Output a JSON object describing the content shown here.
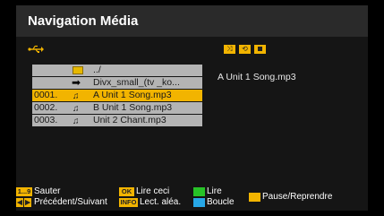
{
  "header": {
    "title": "Navigation Média"
  },
  "icons": {
    "usb": "usb-icon",
    "shuffle": "shuffle-icon",
    "repeat": "repeat-icon",
    "stop": "stop-icon"
  },
  "files": [
    {
      "num": "",
      "name": "../",
      "icon": "folder-icon"
    },
    {
      "num": "",
      "name": "Divx_small_(tv _ko...",
      "icon": "arrow-right-icon"
    },
    {
      "num": "0001.",
      "name": "A Unit 1 Song.mp3",
      "icon": "music-note-icon"
    },
    {
      "num": "0002.",
      "name": "B  Unit 1 Song.mp3",
      "icon": "music-note-icon"
    },
    {
      "num": "0003.",
      "name": "Unit 2 Chant.mp3",
      "icon": "music-note-icon"
    }
  ],
  "detail": {
    "filename": "A Unit 1 Song.mp3"
  },
  "footer": {
    "key_digits": "1...9",
    "skip": "Sauter",
    "key_ok": "OK",
    "play_this": "Lire ceci",
    "play": "Lire",
    "pause_resume": "Pause/Reprendre",
    "prev_next": "Précédent/Suivant",
    "key_info": "INFO",
    "shuffle_play": "Lect. aléa.",
    "loop": "Boucle"
  },
  "colors": {
    "yellow": "#f2b400",
    "green": "#27c227",
    "blue": "#27a7e6",
    "row_gray": "#b4b4b4"
  }
}
